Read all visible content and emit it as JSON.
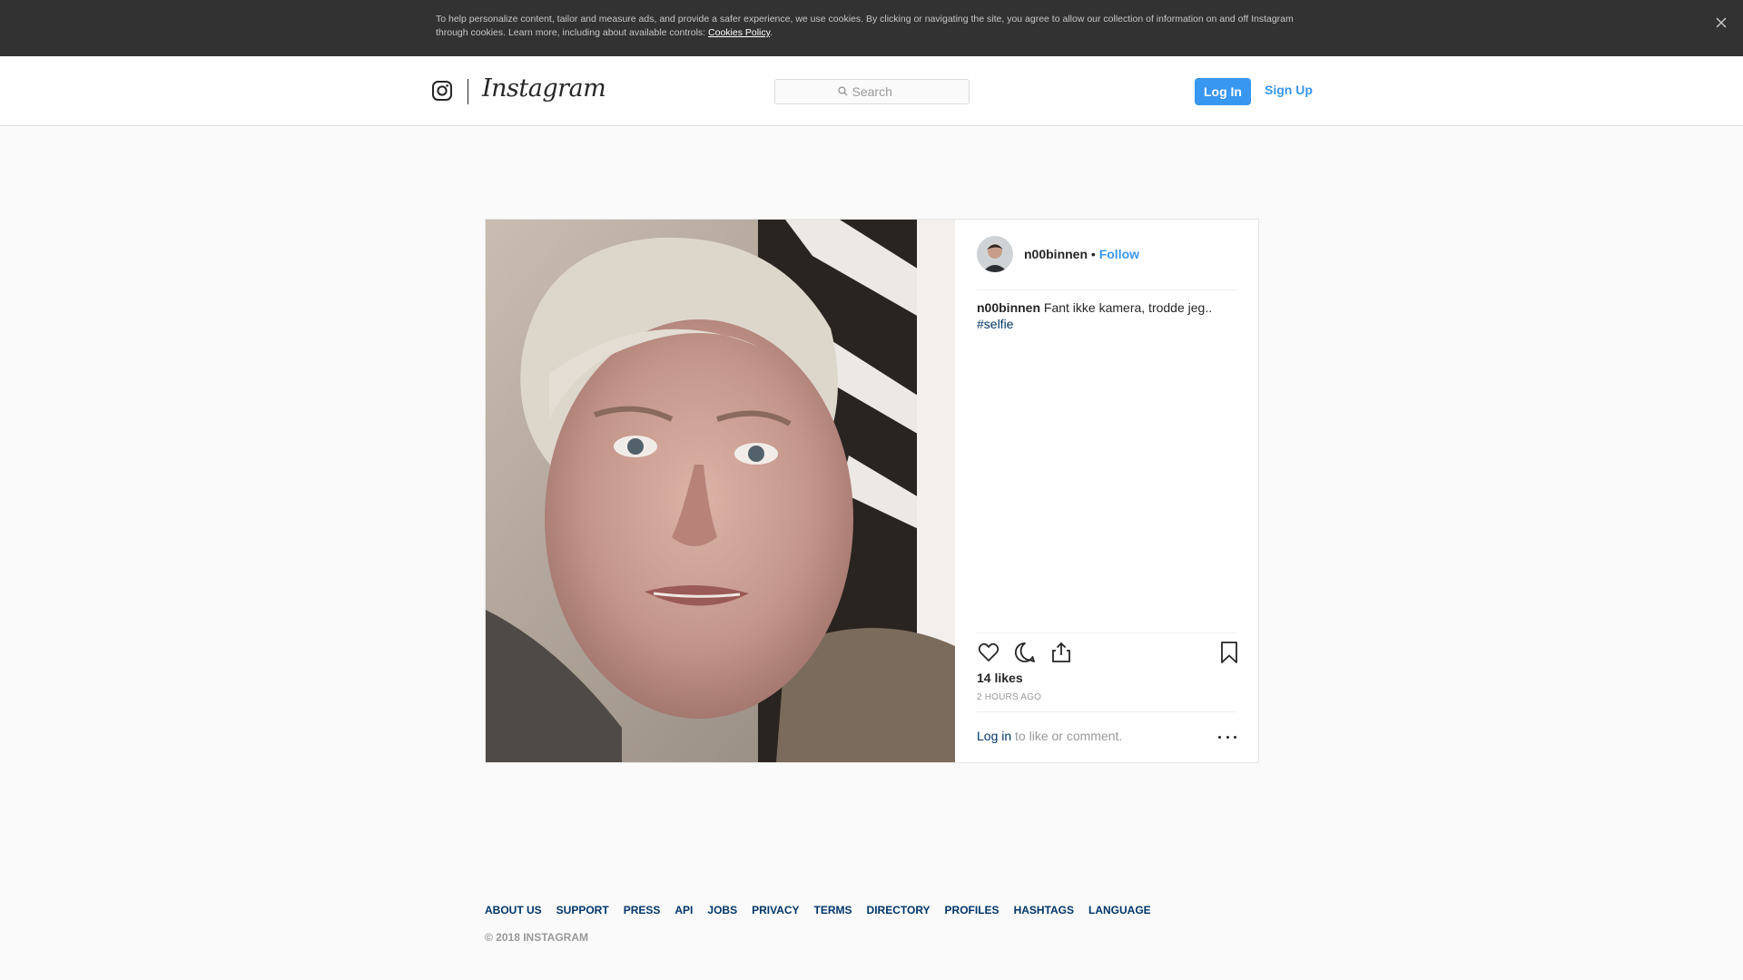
{
  "cookie_banner": {
    "text": "To help personalize content, tailor and measure ads, and provide a safer experience, we use cookies. By clicking or navigating the site, you agree to allow our collection of information on and off Instagram through cookies. Learn more, including about available controls: ",
    "link_label": "Cookies Policy",
    "suffix": "."
  },
  "header": {
    "wordmark": "Instagram",
    "search_placeholder": "Search",
    "login_label": "Log In",
    "signup_label": "Sign Up"
  },
  "post": {
    "author": "n00binnen",
    "separator": "•",
    "follow_label": "Follow",
    "caption_user": "n00binnen",
    "caption_text": "Fant ikke kamera, trodde jeg..",
    "hashtag": "#selfie",
    "likes": "14 likes",
    "timestamp": "2 HOURS AGO",
    "login_link": "Log in",
    "login_suffix": "to like or comment."
  },
  "footer": {
    "links": [
      "ABOUT US",
      "SUPPORT",
      "PRESS",
      "API",
      "JOBS",
      "PRIVACY",
      "TERMS",
      "DIRECTORY",
      "PROFILES",
      "HASHTAGS",
      "LANGUAGE"
    ],
    "copyright": "© 2018 INSTAGRAM"
  },
  "colors": {
    "accent": "#3897f0",
    "link_dark": "#003569",
    "banner_bg": "#323232"
  },
  "icons": [
    "close-icon",
    "instagram-glyph-icon",
    "search-icon",
    "heart-icon",
    "comment-icon",
    "share-icon",
    "bookmark-icon",
    "more-options-icon"
  ]
}
